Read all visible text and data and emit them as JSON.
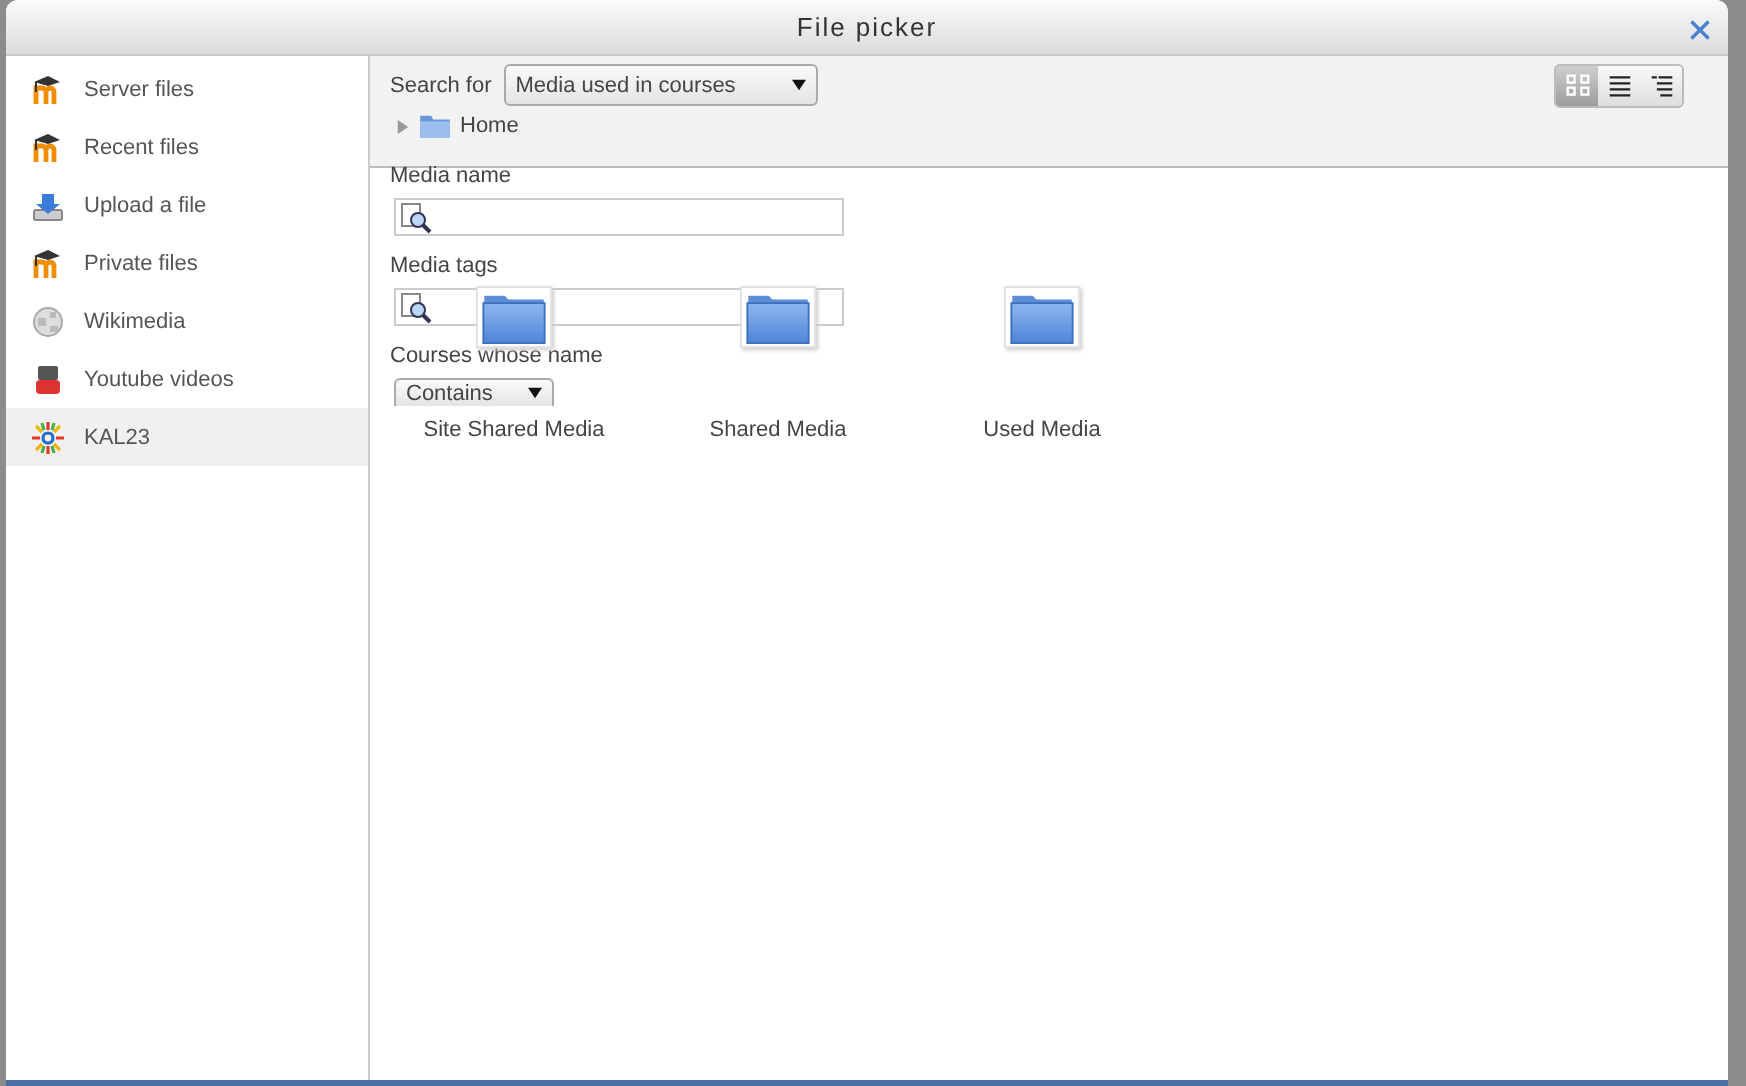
{
  "window": {
    "title": "File picker"
  },
  "sidebar": {
    "items": [
      {
        "label": "Server files",
        "kind": "hat",
        "selected": false
      },
      {
        "label": "Recent files",
        "kind": "hat",
        "selected": false
      },
      {
        "label": "Upload a file",
        "kind": "upload",
        "selected": false
      },
      {
        "label": "Private files",
        "kind": "hat",
        "selected": false
      },
      {
        "label": "Wikimedia",
        "kind": "globe",
        "selected": false
      },
      {
        "label": "Youtube videos",
        "kind": "video",
        "selected": false
      },
      {
        "label": "KAL23",
        "kind": "burst",
        "selected": true
      }
    ]
  },
  "toolbar": {
    "search_label": "Search for",
    "search_value": "Media used in courses",
    "breadcrumb": "Home",
    "views": [
      {
        "kind": "icons",
        "selected": true
      },
      {
        "kind": "list",
        "selected": false
      },
      {
        "kind": "tree",
        "selected": false
      }
    ]
  },
  "form": {
    "fields": [
      {
        "label": "Media name",
        "kind": "search"
      },
      {
        "label": "Media tags",
        "kind": "search"
      },
      {
        "label": "Courses whose name",
        "kind": "select",
        "value": "Contains"
      }
    ]
  },
  "folders": [
    {
      "name": "Site Shared Media"
    },
    {
      "name": "Shared Media"
    },
    {
      "name": "Used Media"
    }
  ]
}
